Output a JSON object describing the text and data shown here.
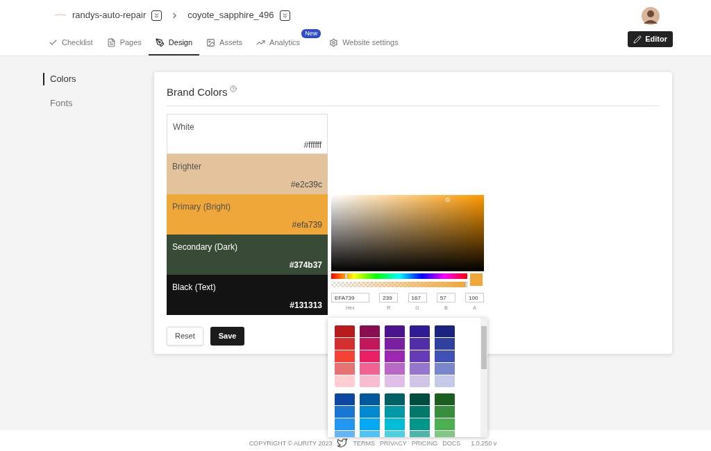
{
  "breadcrumb": [
    {
      "label": "randys-auto-repair"
    },
    {
      "label": "coyote_sapphire_496"
    }
  ],
  "tabs": [
    {
      "label": "Checklist",
      "selected": false
    },
    {
      "label": "Pages",
      "selected": false
    },
    {
      "label": "Design",
      "selected": true
    },
    {
      "label": "Assets",
      "selected": false
    },
    {
      "label": "Analytics",
      "selected": false,
      "badge": "New"
    },
    {
      "label": "Website settings",
      "selected": false
    }
  ],
  "editor_button": "Editor",
  "sidebar": {
    "items": [
      {
        "label": "Colors",
        "selected": true
      },
      {
        "label": "Fonts",
        "selected": false
      }
    ]
  },
  "card": {
    "title": "Brand Colors",
    "colors": [
      {
        "name": "White",
        "hex": "#ffffff",
        "color": "#ffffff"
      },
      {
        "name": "Brighter",
        "hex": "#e2c39c",
        "color": "#e2c39c"
      },
      {
        "name": "Primary (Bright)",
        "hex": "#efa739",
        "color": "#efa739"
      },
      {
        "name": "Secondary (Dark)",
        "hex": "#374b37",
        "color": "#374b37"
      },
      {
        "name": "Black (Text)",
        "hex": "#131313",
        "color": "#131313"
      }
    ],
    "buttons": [
      "Reset",
      "Save"
    ]
  },
  "picker": {
    "hue_slider": {
      "level": 0.1
    },
    "alpha_slider": {
      "level": 1
    },
    "fields": [
      {
        "label": "Hex",
        "value": "EFA739"
      },
      {
        "label": "R",
        "value": "239"
      },
      {
        "label": "G",
        "value": "167"
      },
      {
        "label": "B",
        "value": "57"
      },
      {
        "label": "A",
        "value": "100"
      }
    ]
  },
  "palette": {
    "groups": [
      {
        "columns": [
          {
            "swatches": [
              {
                "color": "#b71c1c"
              },
              {
                "color": "#d32f2f"
              },
              {
                "color": "#f44336"
              },
              {
                "color": "#e57373"
              },
              {
                "color": "#ffcdd2"
              }
            ]
          },
          {
            "swatches": [
              {
                "color": "#880e4f"
              },
              {
                "color": "#c2185b"
              },
              {
                "color": "#e91e63"
              },
              {
                "color": "#f06292"
              },
              {
                "color": "#f8bbd0"
              }
            ]
          },
          {
            "swatches": [
              {
                "color": "#4a148c"
              },
              {
                "color": "#7b1fa2"
              },
              {
                "color": "#9c27b0"
              },
              {
                "color": "#ba68c8"
              },
              {
                "color": "#e1bee7"
              }
            ]
          },
          {
            "swatches": [
              {
                "color": "#311b92"
              },
              {
                "color": "#512da8"
              },
              {
                "color": "#673ab7"
              },
              {
                "color": "#9575cd"
              },
              {
                "color": "#d1c4e9"
              }
            ]
          },
          {
            "swatches": [
              {
                "color": "#1a237e"
              },
              {
                "color": "#303f9f"
              },
              {
                "color": "#3f51b5"
              },
              {
                "color": "#7986cb"
              },
              {
                "color": "#c5cae9"
              }
            ]
          }
        ]
      },
      {
        "columns": [
          {
            "swatches": [
              {
                "color": "#0d47a1"
              },
              {
                "color": "#1976d2"
              },
              {
                "color": "#2196f3"
              },
              {
                "color": "#64b5f6"
              }
            ]
          },
          {
            "swatches": [
              {
                "color": "#01579b"
              },
              {
                "color": "#0288d1"
              },
              {
                "color": "#03a9f4"
              },
              {
                "color": "#4fc3f7"
              }
            ]
          },
          {
            "swatches": [
              {
                "color": "#006064"
              },
              {
                "color": "#0097a7"
              },
              {
                "color": "#00bcd4"
              },
              {
                "color": "#4dd0e1"
              }
            ]
          },
          {
            "swatches": [
              {
                "color": "#004d40"
              },
              {
                "color": "#00796b"
              },
              {
                "color": "#009688"
              },
              {
                "color": "#4db6ac"
              }
            ]
          },
          {
            "swatches": [
              {
                "color": "#1b5e20"
              },
              {
                "color": "#388e3c"
              },
              {
                "color": "#4caf50"
              },
              {
                "color": "#81c784"
              }
            ]
          }
        ]
      }
    ]
  },
  "footer": {
    "copyright": "COPYRIGHT © AURITY 2023",
    "links": [
      "TERMS",
      "PRIVACY",
      "PRICING",
      "DOCS"
    ],
    "version": "1.0.250 v"
  }
}
